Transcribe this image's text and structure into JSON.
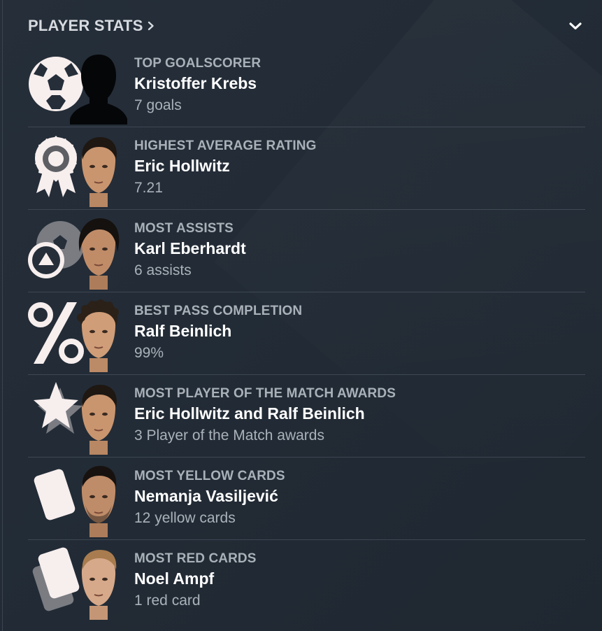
{
  "header": {
    "title": "PLAYER STATS",
    "title_icon": "chevron-right-icon",
    "collapse_icon": "chevron-down-icon"
  },
  "colors": {
    "background": "#232c36",
    "category_text": "#a9b0b8",
    "name_text": "#ffffff",
    "value_text": "#aab1b9",
    "divider": "#3d4753",
    "icon_fill": "#f7eeee"
  },
  "stats": [
    {
      "category": "TOP GOALSCORER",
      "player": "Kristoffer Krebs",
      "value": "7 goals",
      "icon": "football-icon",
      "face": "silhouette"
    },
    {
      "category": "HIGHEST AVERAGE RATING",
      "player": "Eric Hollwitz",
      "value": "7.21",
      "icon": "rosette-award-icon",
      "face": "dark-hair"
    },
    {
      "category": "MOST ASSISTS",
      "player": "Karl Eberhardt",
      "value": "6 assists",
      "icon": "assist-icon",
      "face": "long-dark-hair"
    },
    {
      "category": "BEST PASS COMPLETION",
      "player": "Ralf Beinlich",
      "value": "99%",
      "icon": "percent-icon",
      "face": "curly-hair"
    },
    {
      "category": "MOST PLAYER OF THE MATCH AWARDS",
      "player": "Eric Hollwitz and Ralf Beinlich",
      "value": "3 Player of the Match awards",
      "icon": "star-icon",
      "face": "dark-hair"
    },
    {
      "category": "MOST YELLOW CARDS",
      "player": "Nemanja Vasiljević",
      "value": "12 yellow cards",
      "icon": "card-icon",
      "face": "dark-hair-beard"
    },
    {
      "category": "MOST RED CARDS",
      "player": "Noel Ampf",
      "value": "1 red card",
      "icon": "card-icon",
      "face": "blond-hair"
    }
  ]
}
